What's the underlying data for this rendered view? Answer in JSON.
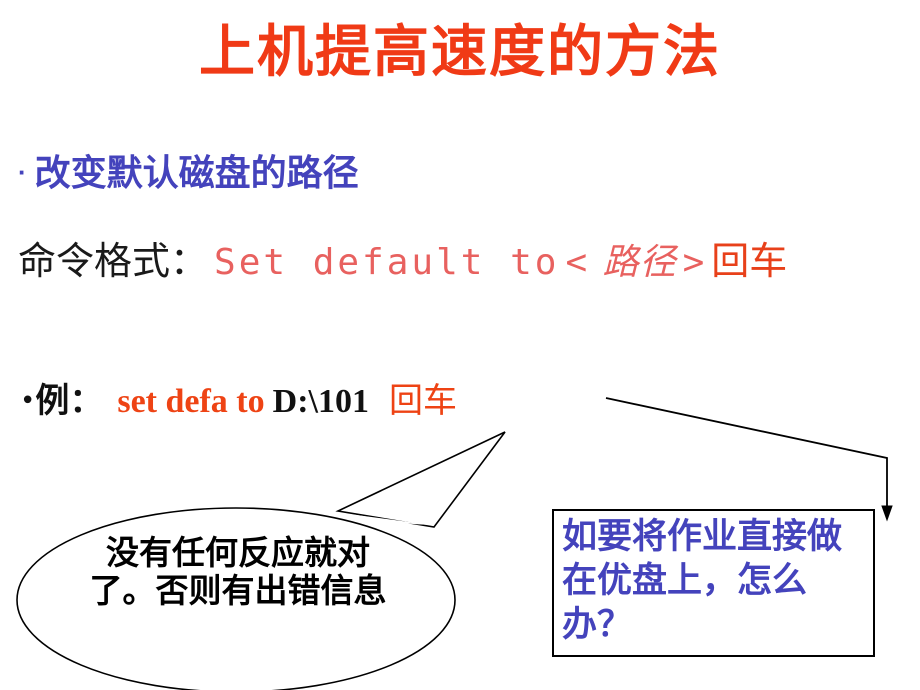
{
  "slide": {
    "background_color": "#ffffff",
    "title": "上机提高速度的方法",
    "title_color": "#F03A16"
  },
  "bullets": [
    {
      "marker": "·",
      "text": "改变默认磁盘的路径",
      "color": "#4443BC"
    }
  ],
  "command_line": {
    "label": "命令格式：",
    "label_color": "#1a1a1a",
    "command": "Set default to",
    "command_color": "#E8615F",
    "argument_open": "<",
    "argument": " 路径",
    "argument_close": ">",
    "enter_key": "回车",
    "enter_color": "#E8401A"
  },
  "example_line": {
    "marker": "•",
    "label": "例：",
    "command": "set defa to",
    "command_color": "#EE4314",
    "path": "D:\\101",
    "path_color": "#111111",
    "enter_key": "回车",
    "enter_color": "#EE4314"
  },
  "ellipse_callout": {
    "text": "没有任何反应就对了。否则有出错信息",
    "text_color": "#000000",
    "border_color": "#000000",
    "fill_color": "#ffffff"
  },
  "question_box": {
    "text": "如要将作业直接做在优盘上，怎么办？",
    "text_color": "#4443BC",
    "border_color": "#000000",
    "fill_color": "#ffffff"
  },
  "connector_arrow": {
    "color": "#000000",
    "description": "elbow-arrow-from-example-to-question-box"
  }
}
